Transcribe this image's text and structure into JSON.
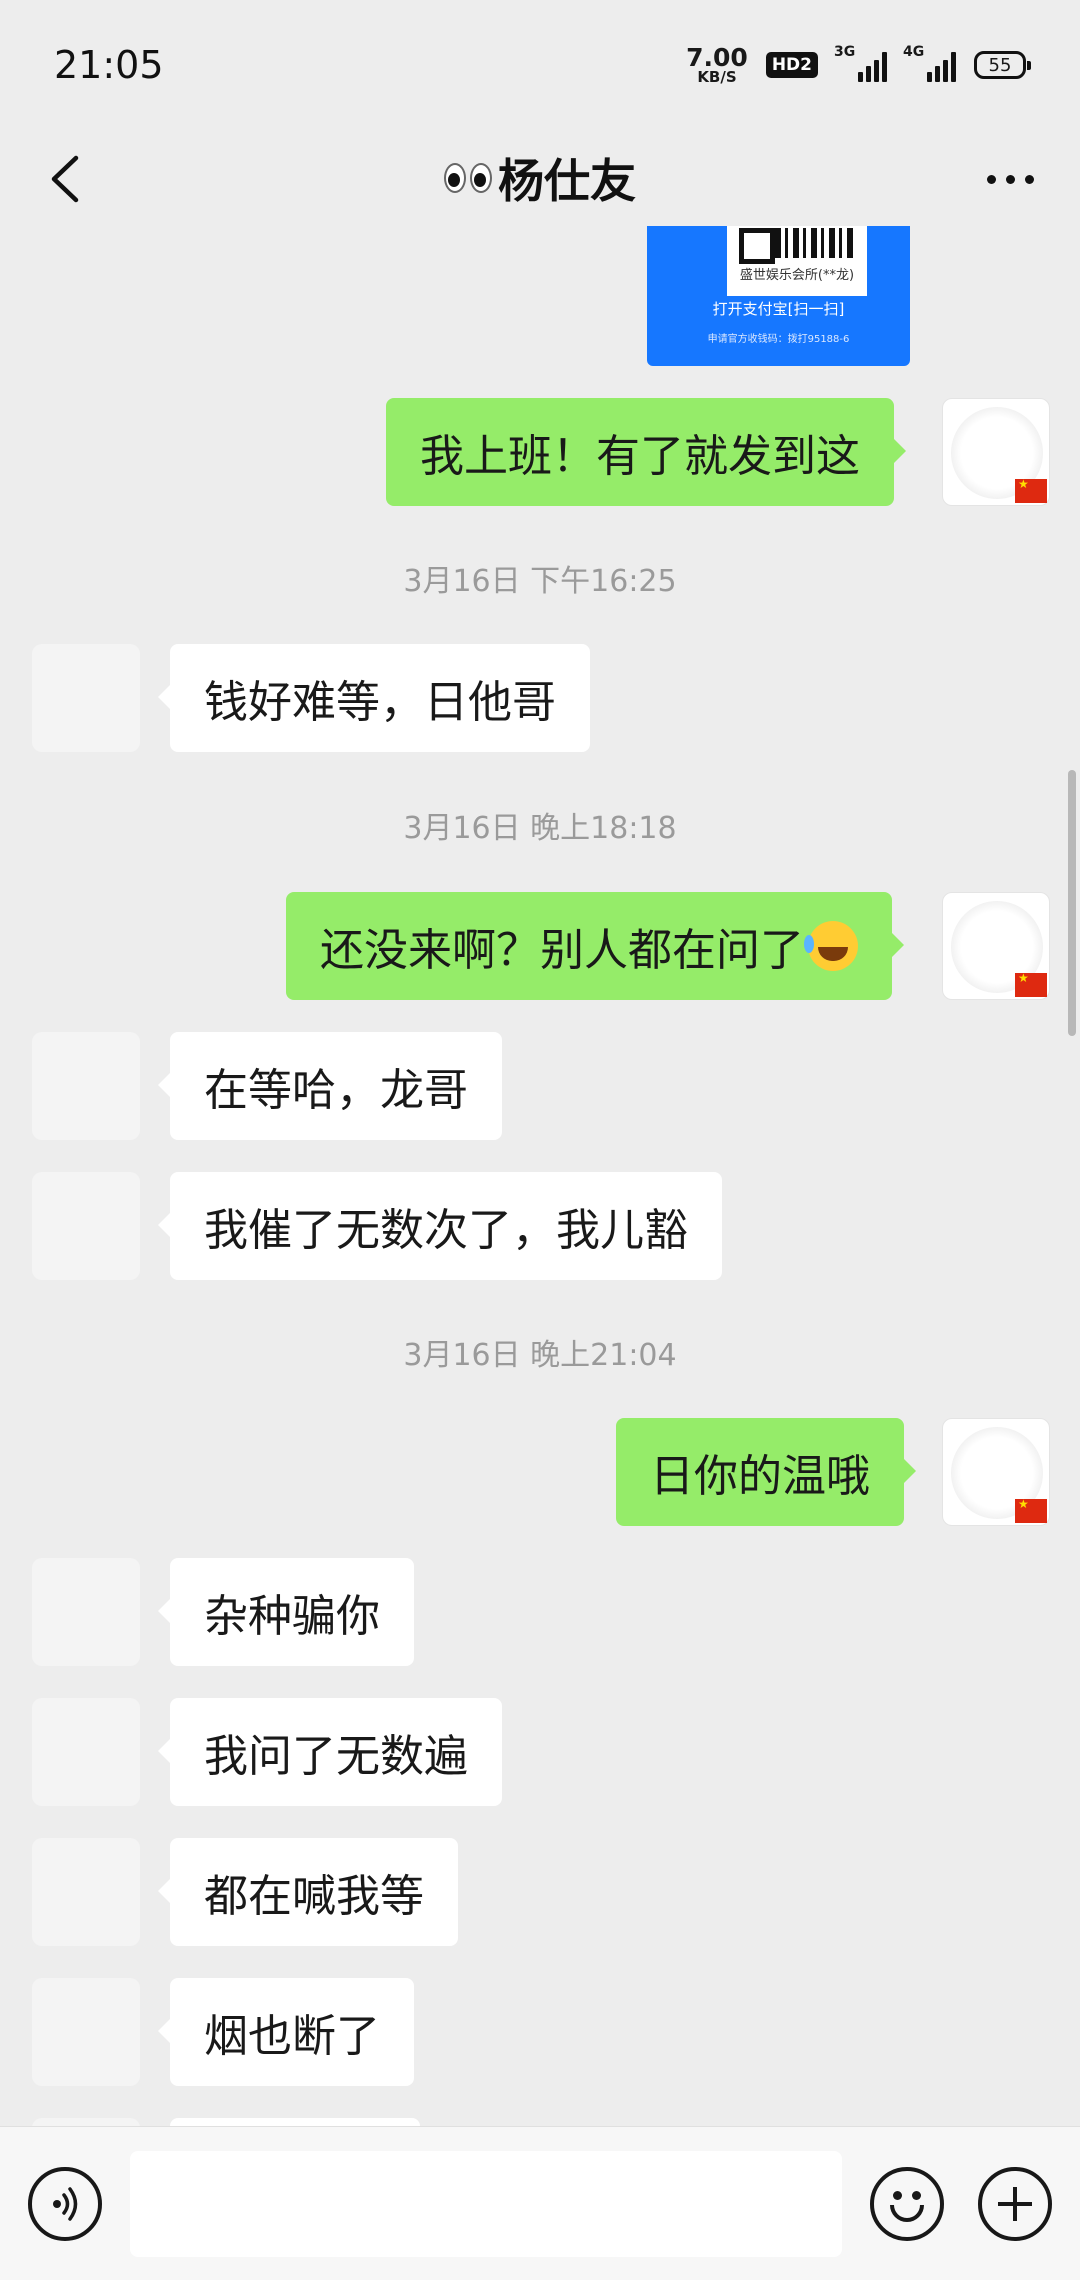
{
  "status_bar": {
    "time": "21:05",
    "net_speed": "7.00",
    "net_unit": "KB/S",
    "hd_label": "HD2",
    "sim1_label": "3G",
    "sim2_label": "4G",
    "battery": "55"
  },
  "header": {
    "title": "杨仕友",
    "title_prefix_icon": "eyes-emoji"
  },
  "qr_card": {
    "merchant": "盛世娱乐会所(**龙)",
    "open_text": "打开支付宝[扫一扫]",
    "apply_text": "申请官方收钱码：拨打95188-6",
    "color": "#1677ff"
  },
  "timestamps": {
    "t1": "3月16日 下午16:25",
    "t2": "3月16日 晚上18:18",
    "t3": "3月16日 晚上21:04"
  },
  "messages": [
    {
      "side": "right",
      "text": "我上班！有了就发到这"
    },
    {
      "side": "left",
      "text": "钱好难等，日他哥"
    },
    {
      "side": "right",
      "text": "还没来啊？别人都在问了",
      "emoji": "laughing-crying-emoji"
    },
    {
      "side": "left",
      "text": "在等哈，龙哥"
    },
    {
      "side": "left",
      "text": "我催了无数次了，我儿豁"
    },
    {
      "side": "right",
      "text": "日你的温哦"
    },
    {
      "side": "left",
      "text": "杂种骗你"
    },
    {
      "side": "left",
      "text": "我问了无数遍"
    },
    {
      "side": "left",
      "text": "都在喊我等"
    },
    {
      "side": "left",
      "text": "烟也断了"
    }
  ],
  "input_bar": {
    "placeholder": "",
    "voice_icon": "voice-icon",
    "emoji_icon": "emoji-icon",
    "plus_icon": "plus-icon"
  },
  "colors": {
    "background": "#ededed",
    "my_bubble": "#95ec69",
    "peer_bubble": "#ffffff"
  }
}
